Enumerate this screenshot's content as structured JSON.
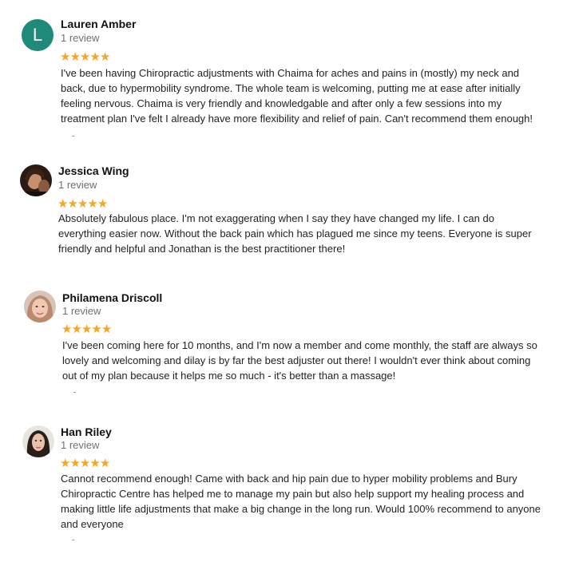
{
  "reviews": [
    {
      "author": "Lauren Amber",
      "review_count": "1 review",
      "avatar": {
        "kind": "letter",
        "letter": "L",
        "color": "#1f8a7a"
      },
      "rating": 5,
      "lines": [
        "I've been having Chiropractic adjustments with Chaima for aches and pains in (mostly) my neck and",
        "back, due to hypermobility syndrome. The whole team is welcoming, putting me at ease after initially",
        "feeling nervous. Chaima is very friendly and knowledgable and after only a few sessions into my",
        "treatment plan I've felt I already have more flexibility and relief of pain. Can't recommend them enough!"
      ]
    },
    {
      "author": "Jessica Wing",
      "review_count": "1 review",
      "avatar": {
        "kind": "photo",
        "icon": "user-photo"
      },
      "rating": 5,
      "lines": [
        "Absolutely fabulous place. I'm not exaggerating when I say they have changed my life. I can do",
        "everything easier now. Without the back pain which has plagued me since my teens. Everyone is super",
        "friendly and helpful and Jonathan is the best practitioner there!"
      ]
    },
    {
      "author": "Philamena Driscoll",
      "review_count": "1 review",
      "avatar": {
        "kind": "photo",
        "icon": "user-photo"
      },
      "rating": 5,
      "lines": [
        "I've been coming here for 10 months, and I'm now a member and come monthly, the staff are always so",
        "lovely and welcoming and dilay is by far the best adjuster out there! I wouldn't ever think about coming",
        "out of my plan because it helps me so much - it's better than a massage!"
      ]
    },
    {
      "author": "Han Riley",
      "review_count": "1 review",
      "avatar": {
        "kind": "photo",
        "icon": "user-photo"
      },
      "rating": 5,
      "lines": [
        "Cannot recommend enough! Came with back and hip pain due to hyper mobility problems and Bury",
        "Chiropractic Centre has helped me to manage my pain but also help support my healing process and",
        "making little life adjustments that make a big change in the long run. Would 100% recommend to anyone",
        "and everyone"
      ]
    }
  ]
}
